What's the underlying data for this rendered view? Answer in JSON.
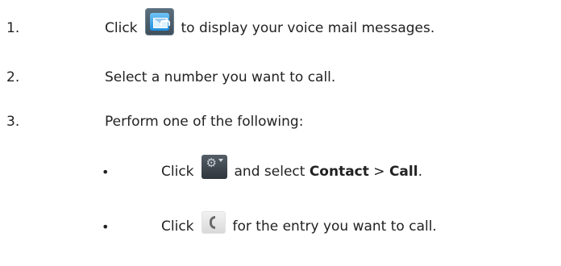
{
  "steps": [
    {
      "number": "1.",
      "text_before": "Click",
      "icon": "voicemail-icon",
      "text_after": "to display your voice mail messages."
    },
    {
      "number": "2.",
      "text": "Select a number you want to call."
    },
    {
      "number": "3.",
      "text": "Perform one of the following:"
    }
  ],
  "sub_steps": [
    {
      "bullet": "•",
      "text_before": "Click",
      "icon": "gear-menu-icon",
      "text_mid": "and select",
      "bold1": "Contact",
      "separator": ">",
      "bold2": "Call",
      "end": "."
    },
    {
      "bullet": "•",
      "text_before": "Click",
      "icon": "phone-icon",
      "text_after": "for the entry you want to call."
    }
  ]
}
